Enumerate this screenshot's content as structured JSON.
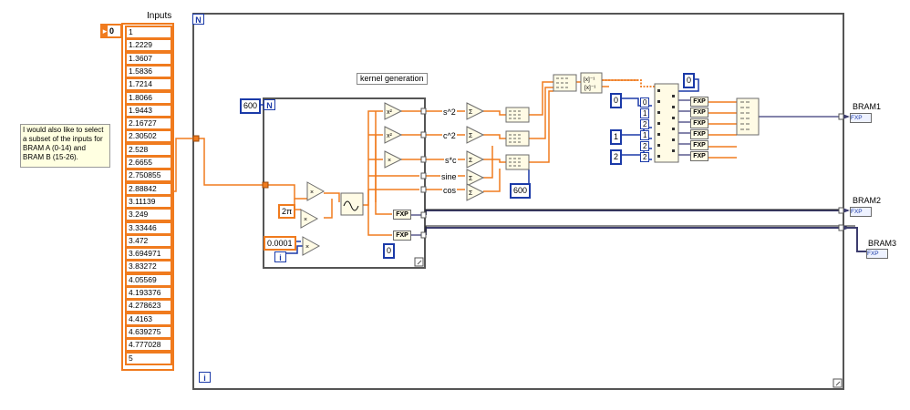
{
  "inputs": {
    "title": "Inputs",
    "index": "0",
    "values": [
      "1",
      "1.2229",
      "1.3607",
      "1.5836",
      "1.7214",
      "1.8066",
      "1.9443",
      "2.16727",
      "2.30502",
      "2.528",
      "2.6655",
      "2.750855",
      "2.88842",
      "3.11139",
      "3.249",
      "3.33446",
      "3.472",
      "3.694971",
      "3.83272",
      "4.05569",
      "4.193376",
      "4.278623",
      "4.4163",
      "4.639275",
      "4.777028",
      "5"
    ]
  },
  "comment": "I would also like to select a subset of the inputs for BRAM A (0-14) and BRAM B (15-26).",
  "outer_loop": {
    "n_label": "N",
    "i_label": "i"
  },
  "inner_loop": {
    "n_label": "N",
    "i_label": "i",
    "count": "600",
    "label": "kernel generation",
    "two_pi": "2π",
    "step": "0.0001",
    "zero": "0",
    "fxp": "FXP",
    "outputs": [
      "s^2",
      "c^2",
      "s*c",
      "sine",
      "cos"
    ]
  },
  "right": {
    "const_600": "600",
    "const_0": "0",
    "const_0b": "0",
    "idx": [
      "0",
      "1",
      "2",
      "1",
      "2",
      "2"
    ],
    "const_1": "1",
    "const_2": "2",
    "fxp_labels": [
      "FXP",
      "FXP",
      "FXP",
      "FXP",
      "FXP",
      "FXP"
    ]
  },
  "outputs": [
    {
      "name": "BRAM1",
      "tag": "FXP"
    },
    {
      "name": "BRAM2",
      "tag": "FXP"
    },
    {
      "name": "BRAM3",
      "tag": "FXP"
    }
  ],
  "colors": {
    "fixed": "#f07b1e",
    "integer": "#1b3aa8",
    "structure": "#555555"
  }
}
